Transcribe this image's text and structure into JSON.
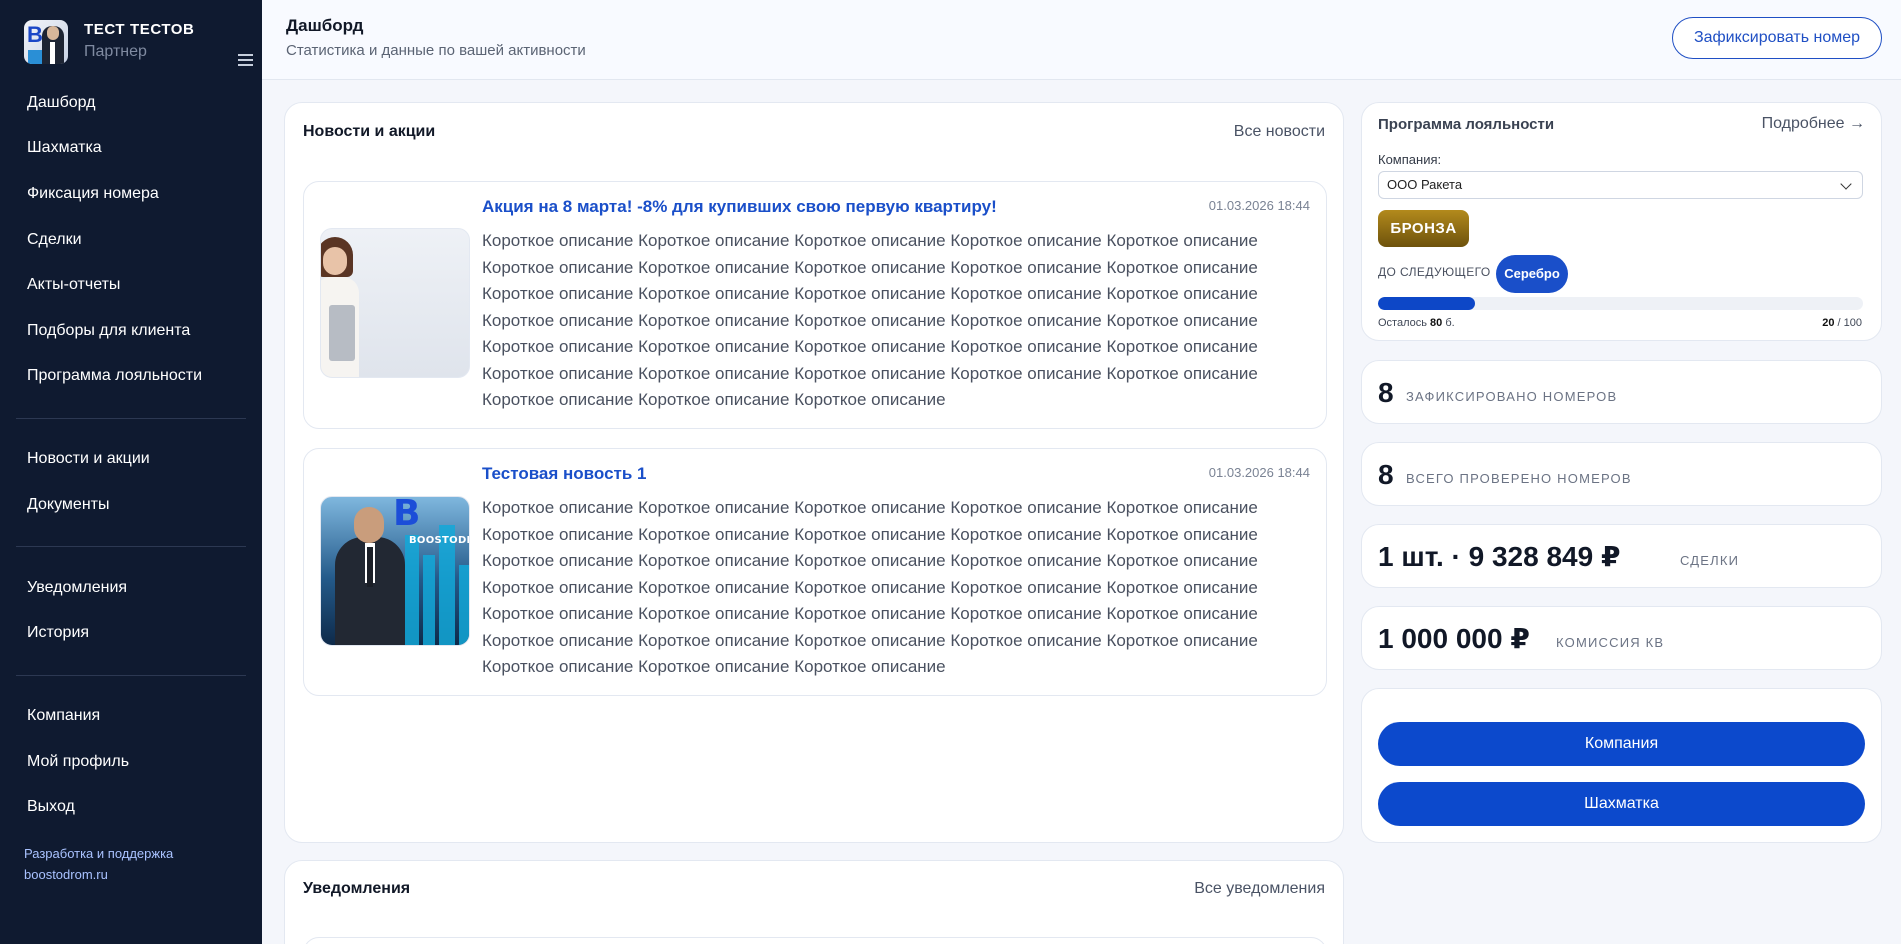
{
  "profile": {
    "name": "ТЕСТ ТЕСТОВ",
    "role": "Партнер"
  },
  "sidebar": {
    "items": [
      {
        "label": "Дашборд"
      },
      {
        "label": "Шахматка"
      },
      {
        "label": "Фиксация номера"
      },
      {
        "label": "Сделки"
      },
      {
        "label": "Акты-отчеты"
      },
      {
        "label": "Подборы для клиента"
      },
      {
        "label": "Программа лояльности"
      },
      {
        "label": "Новости и акции"
      },
      {
        "label": "Документы"
      },
      {
        "label": "Уведомления"
      },
      {
        "label": "История"
      },
      {
        "label": "Компания"
      },
      {
        "label": "Мой профиль"
      },
      {
        "label": "Выход"
      }
    ],
    "dev_credit_line1": "Разработка и поддержка",
    "dev_credit_line2": "boostodrom.ru"
  },
  "header": {
    "title": "Дашборд",
    "subtitle": "Статистика и данные по вашей активности",
    "fix_button": "Зафиксировать номер"
  },
  "news": {
    "title": "Новости и акции",
    "all_link": "Все новости",
    "items": [
      {
        "headline": "Акция на 8 марта! -8% для купивших свою первую квартиру!",
        "date": "01.03.2026 18:44",
        "description": "Короткое описание Короткое описание Короткое описание Короткое описание Короткое описание Короткое описание Короткое описание Короткое описание Короткое описание Короткое описание Короткое описание Короткое описание Короткое описание Короткое описание Короткое описание Короткое описание Короткое описание Короткое описание Короткое описание Короткое описание Короткое описание Короткое описание Короткое описание Короткое описание Короткое описание Короткое описание Короткое описание Короткое описание Короткое описание Короткое описание Короткое описание Короткое описание Короткое описание"
      },
      {
        "headline": "Тестовая новость 1",
        "date": "01.03.2026 18:44",
        "description": "Короткое описание Короткое описание Короткое описание Короткое описание Короткое описание Короткое описание Короткое описание Короткое описание Короткое описание Короткое описание Короткое описание Короткое описание Короткое описание Короткое описание Короткое описание Короткое описание Короткое описание Короткое описание Короткое описание Короткое описание Короткое описание Короткое описание Короткое описание Короткое описание Короткое описание Короткое описание Короткое описание Короткое описание Короткое описание Короткое описание Короткое описание Короткое описание Короткое описание",
        "image_logo_text": "BOOSTODROM"
      }
    ]
  },
  "notifications": {
    "title": "Уведомления",
    "all_link": "Все уведомления"
  },
  "loyalty": {
    "title": "Программа лояльности",
    "more_link": "Подробнее →",
    "company_label": "Компания:",
    "company_value": "ООО Ракета",
    "current_tier": "БРОНЗА",
    "next_label": "ДО СЛЕДУЮЩЕГО",
    "next_tier": "Серебро",
    "progress_fraction": 0.2,
    "remaining_prefix": "Осталось",
    "remaining_value": "80",
    "remaining_unit": "б.",
    "points_current": "20",
    "points_total": "/ 100",
    "bronze_color": "#9a7616",
    "accent_color": "#0c49cc"
  },
  "stats": [
    {
      "value": "8",
      "label": "ЗАФИКСИРОВАНО НОМЕРОВ"
    },
    {
      "value": "8",
      "label": "ВСЕГО ПРОВЕРЕНО НОМЕРОВ"
    },
    {
      "value": "1 шт. · 9 328 849 ₽",
      "label": "СДЕЛКИ"
    },
    {
      "value": "1 000 000 ₽",
      "label": "КОМИССИЯ КВ"
    }
  ],
  "actions": {
    "company_button": "Компания",
    "chess_button": "Шахматка"
  }
}
